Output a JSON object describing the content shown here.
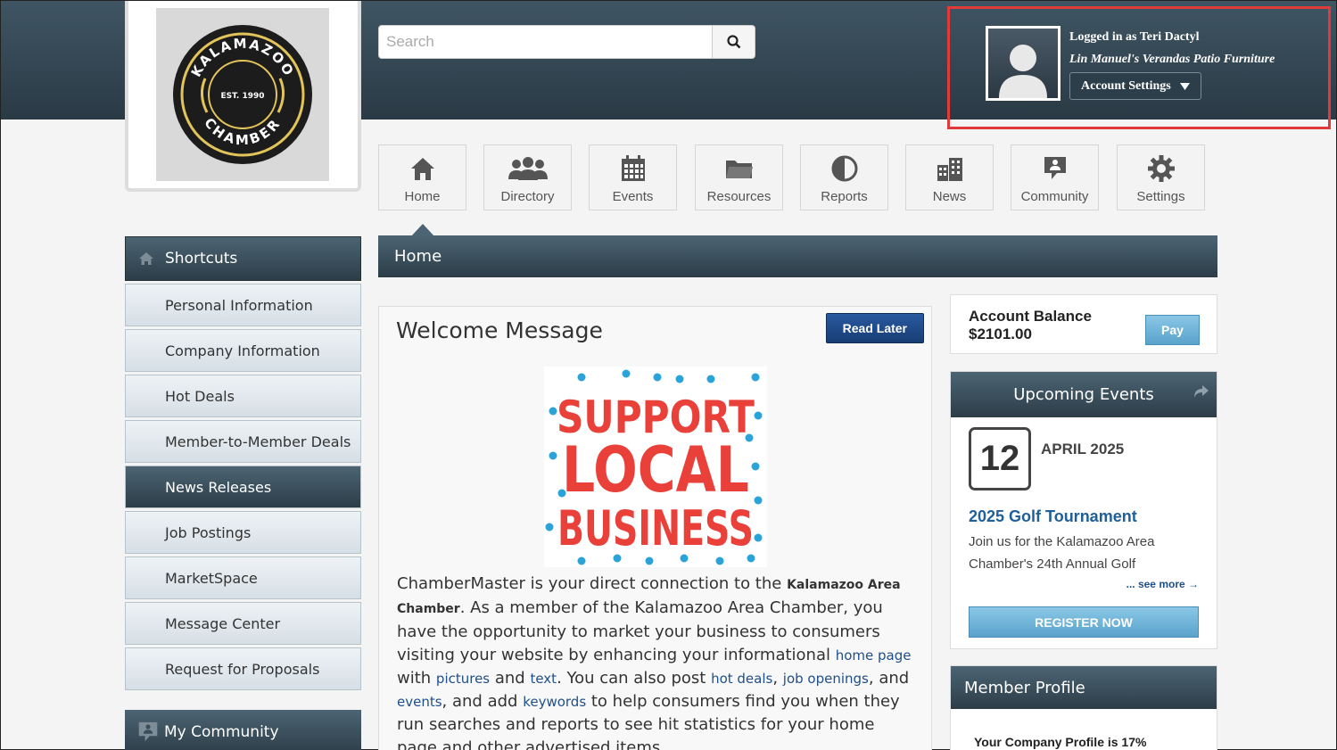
{
  "colors": {
    "header_dark": "#2a3a45",
    "accent_blue": "#1f5f9a",
    "highlight_red": "#e03a3a",
    "button_blue": "#5aa3cb"
  },
  "logo": {
    "org_name": "KALAMAZOO",
    "org_sub": "CHAMBER",
    "est": "EST. 1990"
  },
  "search": {
    "placeholder": "Search",
    "icon": "search-icon"
  },
  "account": {
    "logged_in_as": "Logged in as Teri Dactyl",
    "company": "Lin Manuel's Verandas Patio Furniture",
    "settings_label": "Account Settings"
  },
  "nav": [
    {
      "label": "Home",
      "icon": "home-icon"
    },
    {
      "label": "Directory",
      "icon": "people-icon"
    },
    {
      "label": "Events",
      "icon": "calendar-icon"
    },
    {
      "label": "Resources",
      "icon": "folder-icon"
    },
    {
      "label": "Reports",
      "icon": "pie-chart-icon"
    },
    {
      "label": "News",
      "icon": "buildings-icon"
    },
    {
      "label": "Community",
      "icon": "comment-icon"
    },
    {
      "label": "Settings",
      "icon": "gear-icon"
    }
  ],
  "shortcuts": {
    "title": "Shortcuts",
    "items": [
      "Personal Information",
      "Company Information",
      "Hot Deals",
      "Member-to-Member Deals",
      "News Releases",
      "Job Postings",
      "MarketSpace",
      "Message Center",
      "Request for Proposals"
    ],
    "active_item": "News Releases"
  },
  "my_community": {
    "title": "My Community"
  },
  "home_bar": {
    "title": "Home"
  },
  "welcome": {
    "title": "Welcome Message",
    "read_later": "Read Later",
    "image_text": [
      "SUPPORT",
      "LOCAL",
      "BUSINESS"
    ],
    "p1": "ChamberMaster is your direct connection to the ",
    "org": "Kalamazoo Area Chamber",
    "p2": ". As a member of the Kalamazoo Area Chamber, you have the opportunity to market your business to consumers visiting your website by enhancing your informational ",
    "link_home_page": "home page",
    "p3": " with ",
    "link_pictures": "pictures",
    "p4": " and ",
    "link_text": "text",
    "p5": ". You can also post ",
    "link_hot_deals": "hot deals",
    "p6": ", ",
    "link_job_openings": "job openings",
    "p7": ", and ",
    "link_events": "events",
    "p8": ", and add ",
    "link_keywords": "keywords",
    "p9": " to help consumers find you when they run searches and reports to see hit statistics for your home page and other advertised items."
  },
  "balance": {
    "label": "Account Balance",
    "value": "$2101.00",
    "pay": "Pay"
  },
  "events": {
    "title": "Upcoming Events",
    "day": "12",
    "month": "APRIL 2025",
    "event_title": "2025 Golf Tournament",
    "desc": "Join us for the Kalamazoo Area Chamber's 24th Annual Golf",
    "see_more": "... see more →",
    "register": "REGISTER NOW"
  },
  "member_profile": {
    "title": "Member Profile",
    "text": "Your Company Profile is 17%"
  }
}
